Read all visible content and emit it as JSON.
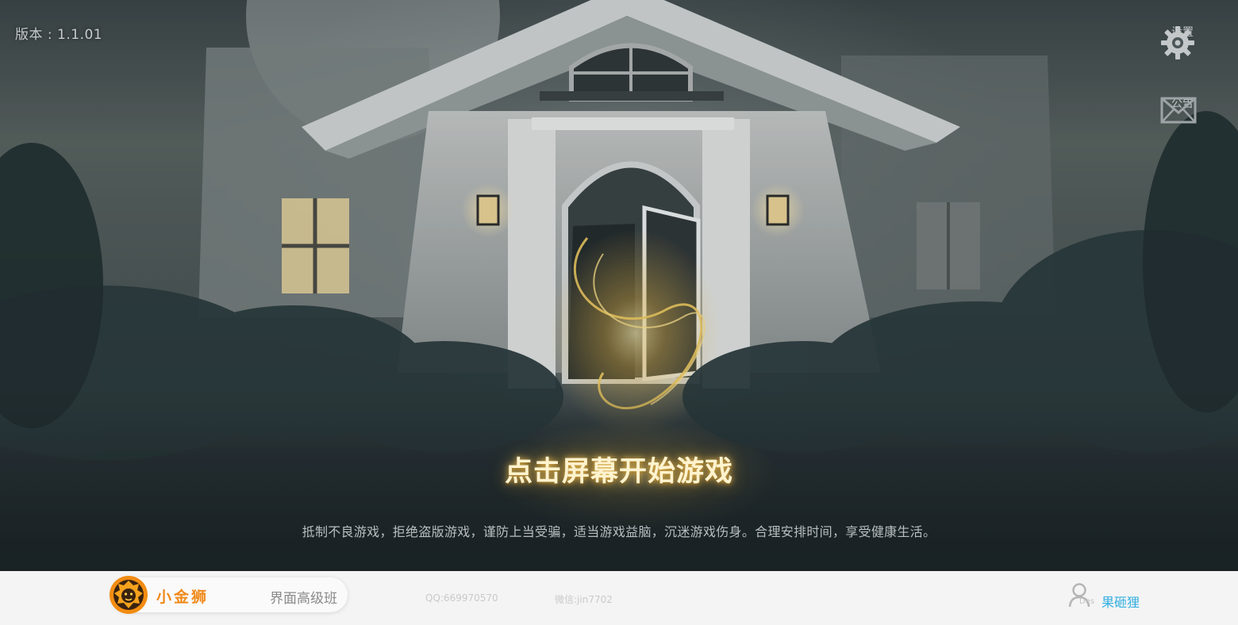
{
  "version": {
    "label": "版本 : 1.1.01"
  },
  "side_buttons": {
    "settings": {
      "label": "设置",
      "icon": "gear-icon"
    },
    "notice": {
      "label": "公告",
      "icon": "envelope-icon"
    }
  },
  "main": {
    "start_prompt": "点击屏幕开始游戏",
    "health_notice": "抵制不良游戏，拒绝盗版游戏，谨防上当受骗，适当游戏益脑，沉迷游戏伤身。合理安排时间，享受健康生活。"
  },
  "footer": {
    "brand_name": "小金狮",
    "course_name": "界面高级班",
    "qq": "QQ:669970570",
    "wechat": "微信:jin7702",
    "author_tag": "Des",
    "author_name": "果砸狸",
    "author_icon": "user-icon",
    "logo_icon": "lion-logo-icon"
  },
  "colors": {
    "accent_gold": "#ffd97a",
    "brand_orange": "#f08a1a",
    "author_blue": "#33aee0"
  }
}
